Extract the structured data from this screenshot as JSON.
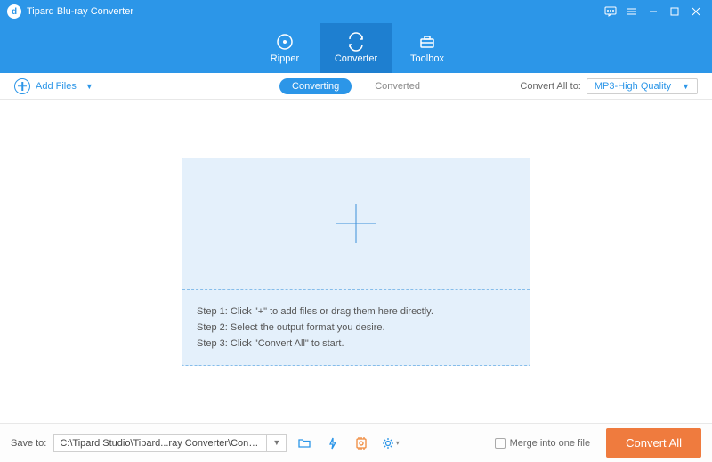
{
  "titlebar": {
    "title": "Tipard Blu-ray Converter"
  },
  "nav": {
    "ripper": "Ripper",
    "converter": "Converter",
    "toolbox": "Toolbox"
  },
  "toolbar": {
    "add_files": "Add Files",
    "tab_converting": "Converting",
    "tab_converted": "Converted",
    "convert_all_label": "Convert All to:",
    "format_selected": "MP3-High Quality"
  },
  "dropzone": {
    "step1": "Step 1: Click \"+\" to add files or drag them here directly.",
    "step2": "Step 2: Select the output format you desire.",
    "step3": "Step 3: Click \"Convert All\" to start."
  },
  "bottom": {
    "save_to_label": "Save to:",
    "path": "C:\\Tipard Studio\\Tipard...ray Converter\\Converted",
    "merge_label": "Merge into one file",
    "convert_all_btn": "Convert All"
  }
}
